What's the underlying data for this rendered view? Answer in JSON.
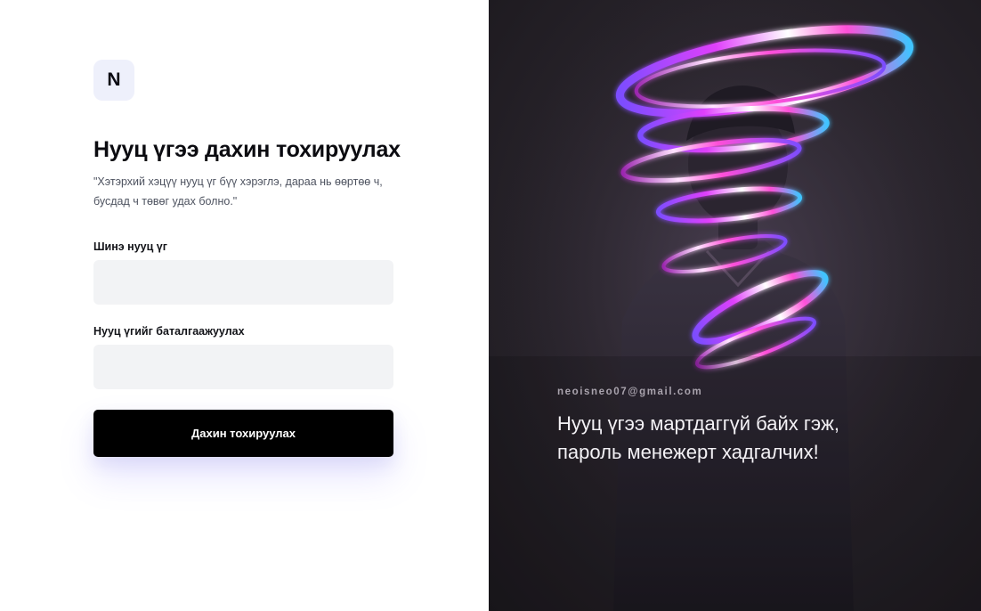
{
  "logo": {
    "letter": "N"
  },
  "form": {
    "title": "Нууц үгээ дахин тохируулах",
    "subtitle": "\"Хэтэрхий хэцүү нууц үг бүү хэрэглэ, дараа нь өөртөө ч, бусдад ч төвөг удах болно.\"",
    "new_password_label": "Шинэ нууц үг",
    "new_password_value": "",
    "confirm_password_label": "Нууц үгийг баталгаажуулах",
    "confirm_password_value": "",
    "submit_label": "Дахин тохируулах"
  },
  "hero": {
    "email": "neoisneo07@gmail.com",
    "quote": "Нууц үгээ мартдаггүй байх гэж, пароль менежерт хадгалчих!",
    "image_icon": "person-with-neon-swirl-illustration"
  },
  "colors": {
    "primary": "#000000",
    "field_bg": "#f2f3f5",
    "logo_bg": "#eef0fb",
    "hero_bg": "#2a252d",
    "neon_pink": "#e040fb",
    "neon_violet": "#7c4dff"
  }
}
